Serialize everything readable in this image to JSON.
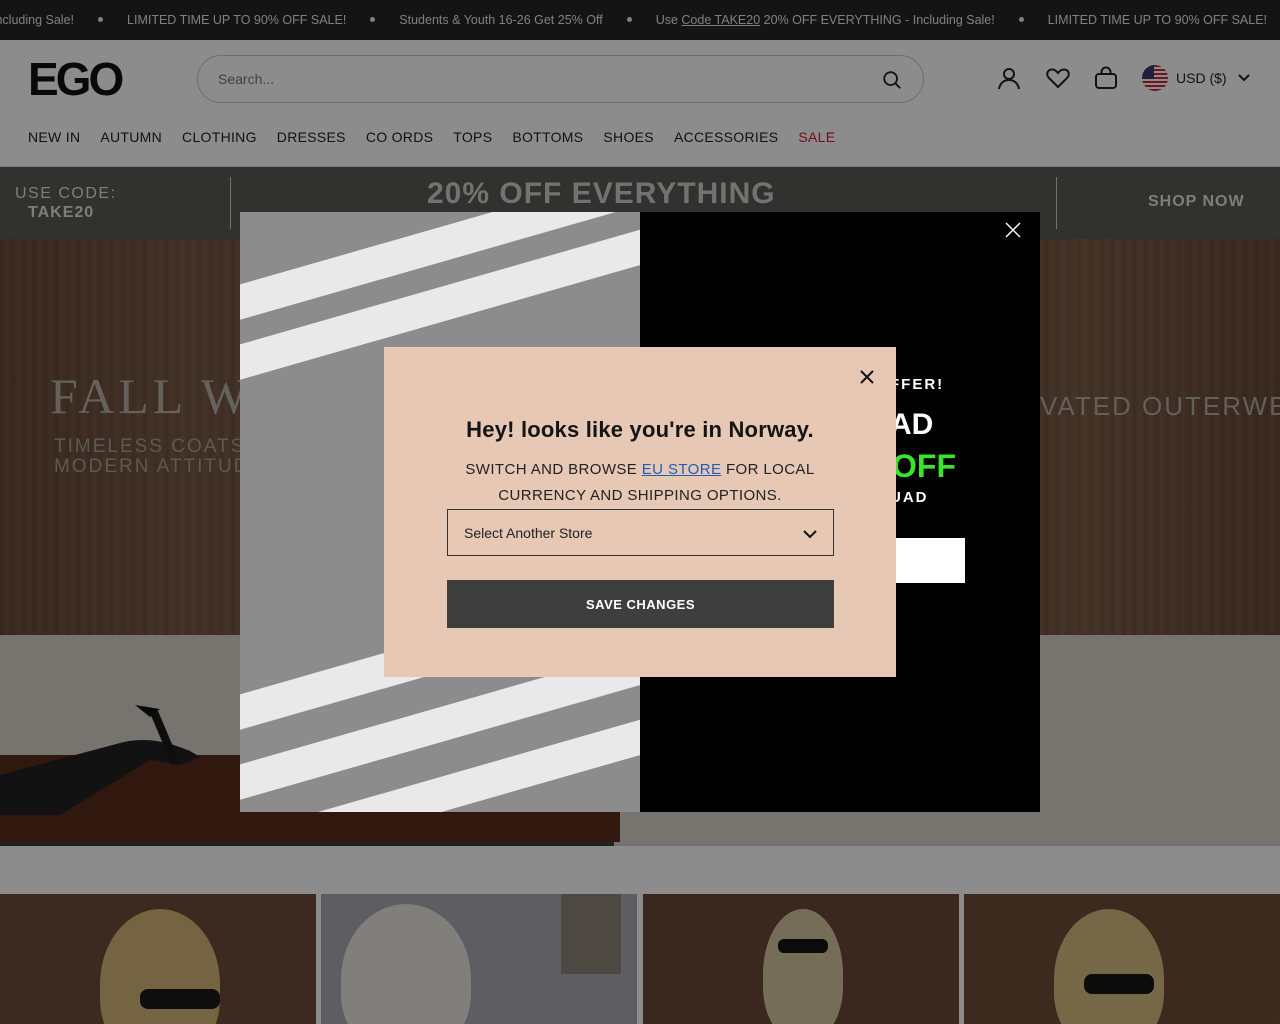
{
  "ticker": {
    "items": [
      {
        "text": "Including Sale!"
      },
      {
        "text": "LIMITED TIME UP TO 90% OFF SALE!"
      },
      {
        "text": "Students & Youth 16-26 Get 25% Off"
      },
      {
        "prefix": "Use ",
        "code": "Code TAKE20",
        "suffix": " 20% OFF EVERYTHING - Including Sale!"
      },
      {
        "text": "LIMITED TIME UP TO 90% OFF SALE!"
      }
    ]
  },
  "header": {
    "logo": "EGO",
    "search_placeholder": "Search...",
    "currency": "USD ($)"
  },
  "nav": [
    "NEW IN",
    "AUTUMN",
    "CLOTHING",
    "DRESSES",
    "CO ORDS",
    "TOPS",
    "BOTTOMS",
    "SHOES",
    "ACCESSORIES",
    "SALE"
  ],
  "promo": {
    "code_label": "USE CODE:",
    "code": "TAKE20",
    "headline": "20% OFF EVERYTHING",
    "cta": "SHOP NOW"
  },
  "hero": {
    "title": "FALL W",
    "subtitle": "TIMELESS COATS\nMODERN ATTITUD",
    "right_text": "VATED OUTERWE"
  },
  "carousel": {
    "progress_percent": 48
  },
  "popup": {
    "offer": "FFER!",
    "big": "AD",
    "off": "OFF",
    "squad": "UAD"
  },
  "modal": {
    "title": "Hey! looks like you're in Norway.",
    "text_before": "SWITCH AND BROWSE ",
    "link": "EU STORE",
    "text_after": " FOR LOCAL CURRENCY AND SHIPPING OPTIONS.",
    "select_value": "Select Another Store",
    "save_label": "SAVE CHANGES"
  },
  "colors": {
    "sale": "#d11d27",
    "accent_green": "#39e52b",
    "modal_bg": "#e6c8b4",
    "button_dark": "#3e3e3e"
  }
}
